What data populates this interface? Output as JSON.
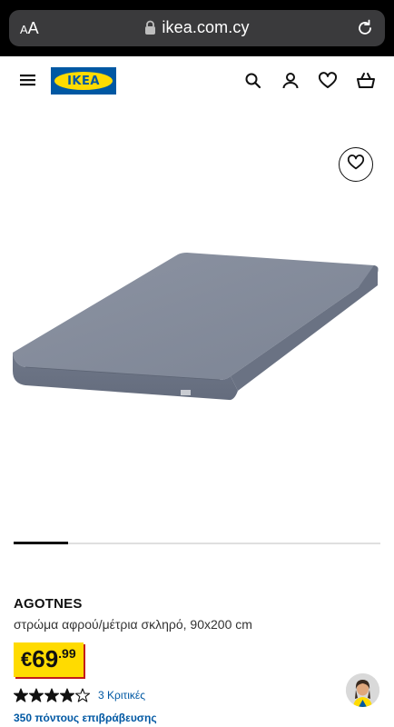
{
  "browser": {
    "aa_small": "A",
    "aa_large": "A",
    "url": "ikea.com.cy"
  },
  "header": {
    "logo_text": "IKEA",
    "icons": [
      "menu-icon",
      "search-icon",
      "user-icon",
      "heart-icon",
      "shopping-bag-icon"
    ]
  },
  "product": {
    "name": "AGOTNES",
    "description": "στρώμα αφρού/μέτρια σκληρό, 90x200 cm",
    "price_currency": "€",
    "price_integer": "69",
    "price_decimal": ".99",
    "rating": 4,
    "rating_max": 5,
    "reviews_label": "3 Κριτικές",
    "points_label": "350 πόντους επιβράβευσης"
  },
  "colors": {
    "ikea_blue": "#0058a3",
    "ikea_yellow": "#ffdb00",
    "mattress": "#7d8596"
  }
}
